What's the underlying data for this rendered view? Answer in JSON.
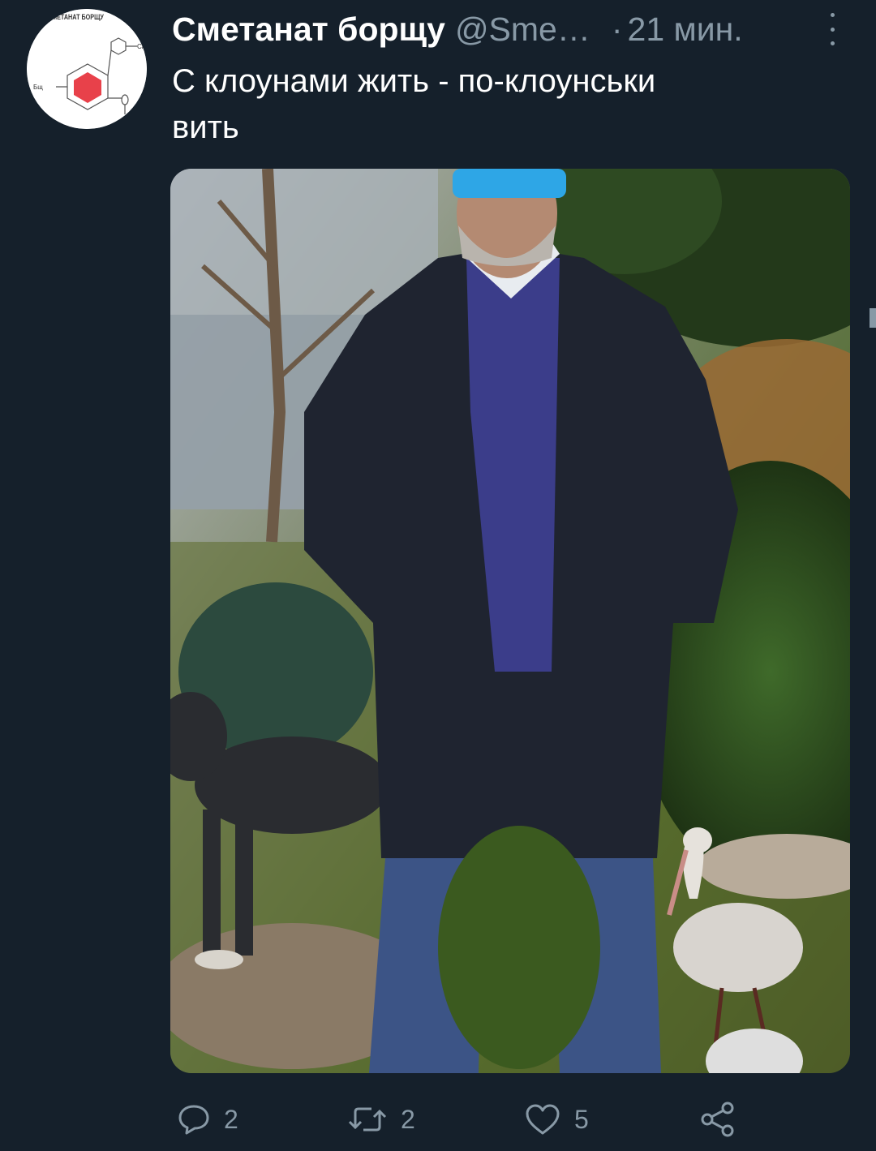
{
  "tweet": {
    "author": {
      "display_name": "Сметанат борщу",
      "handle": "@Sme…",
      "avatar_text": "СМЕТАНАТ БОРЩУ",
      "avatar_label_left": "Бщ",
      "avatar_label_right": "См"
    },
    "separator": "·",
    "timestamp": "21 мин.",
    "text_line1": "С клоунами жить - по-клоунськи",
    "text_line2": "вить",
    "actions": {
      "reply_count": "2",
      "retweet_count": "2",
      "like_count": "5"
    }
  },
  "colors": {
    "background": "#15202b",
    "secondary_text": "#8899a6",
    "primary_text": "#ffffff",
    "avatar_hexagon": "#e8414a",
    "mask": "#2ea6e6"
  },
  "icons": [
    "more-icon",
    "reply-icon",
    "retweet-icon",
    "like-icon",
    "share-icon"
  ]
}
